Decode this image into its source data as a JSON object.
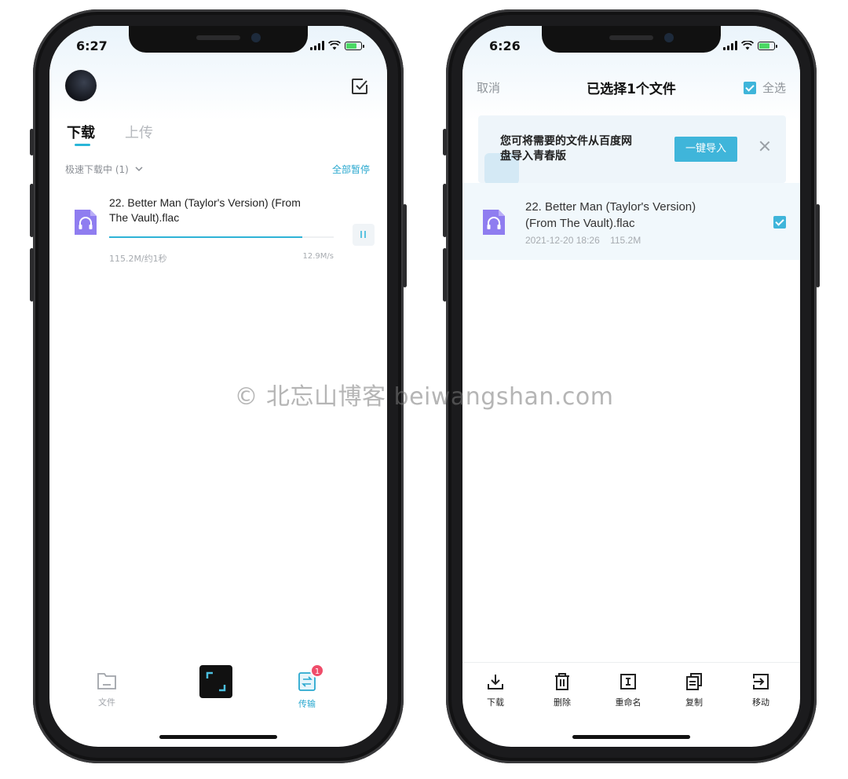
{
  "left_screen": {
    "status": {
      "time": "6:27"
    },
    "tabs": [
      {
        "label": "下载",
        "active": true
      },
      {
        "label": "上传",
        "active": false
      }
    ],
    "section": {
      "title": "极速下载中 (1)",
      "pause_all": "全部暂停"
    },
    "download": {
      "name_line1": "22. Better Man (Taylor's Version) (From",
      "name_line2": "The Vault).flac",
      "progress": 0.86,
      "size_eta": "115.2M/约1秒",
      "speed": "12.9M/s"
    },
    "tabbar": {
      "files_label": "文件",
      "transfer_label": "传输",
      "transfer_badge": "1"
    }
  },
  "right_screen": {
    "status": {
      "time": "6:26"
    },
    "header": {
      "cancel": "取消",
      "title": "已选择1个文件",
      "select_all": "全选"
    },
    "banner": {
      "text_line1": "您可将需要的文件从百度网",
      "text_line2": "盘导入青春版",
      "import_button": "一键导入"
    },
    "selected_file": {
      "name_line1": "22. Better Man (Taylor's Version)",
      "name_line2": "(From The Vault).flac",
      "date": "2021-12-20 18:26",
      "size": "115.2M"
    },
    "toolbar": [
      {
        "label": "下载",
        "icon": "download-icon"
      },
      {
        "label": "删除",
        "icon": "trash-icon"
      },
      {
        "label": "重命名",
        "icon": "rename-icon"
      },
      {
        "label": "复制",
        "icon": "copy-icon"
      },
      {
        "label": "移动",
        "icon": "move-icon"
      }
    ]
  },
  "watermark": "© 北忘山博客 beiwangshan.com",
  "colors": {
    "accent": "#3fb5da",
    "badge": "#ef4d6a",
    "file_icon": "#8f7df0"
  }
}
